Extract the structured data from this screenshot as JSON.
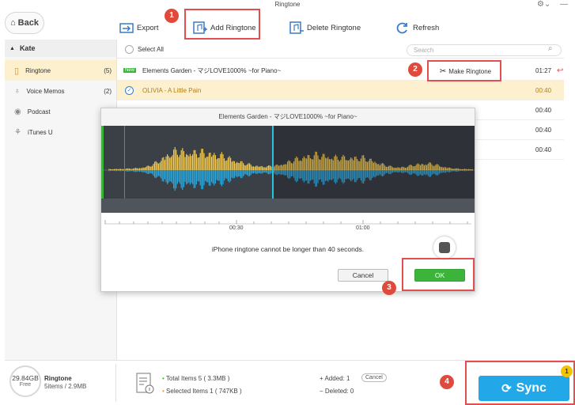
{
  "window": {
    "title": "Ringtone"
  },
  "nav": {
    "back_label": "Back"
  },
  "toolbar": {
    "export_label": "Export",
    "add_ringtone_label": "Add Ringtone",
    "delete_ringtone_label": "Delete Ringtone",
    "refresh_label": "Refresh"
  },
  "sidebar": {
    "device_name": "Kate",
    "items": [
      {
        "label": "Ringtone",
        "count": "(5)"
      },
      {
        "label": "Voice Memos",
        "count": "(2)"
      },
      {
        "label": "Podcast",
        "count": ""
      },
      {
        "label": "iTunes U",
        "count": ""
      }
    ]
  },
  "list": {
    "select_all_label": "Select All",
    "search_placeholder": "Search",
    "rows": [
      {
        "badge": "New",
        "title": "Elements Garden - マジLOVE1000% ~for Piano~",
        "duration": "01:27"
      },
      {
        "title": "OLIVIA - A Little Pain",
        "duration": "00:40"
      },
      {
        "duration": "00:40"
      },
      {
        "duration": "00:40"
      },
      {
        "duration": "00:40"
      }
    ],
    "make_ringtone_label": "Make Ringtone"
  },
  "dialog": {
    "title": "Elements Garden - マジLOVE1000% ~for Piano~",
    "tick_labels": [
      "00:30",
      "01:00"
    ],
    "message": "iPhone ringtone cannot be longer than 40 seconds.",
    "cancel_label": "Cancel",
    "ok_label": "OK"
  },
  "footer": {
    "storage_free": "29.84GB",
    "storage_free_label": "Free",
    "category": "Ringtone",
    "category_summary": "5items / 2.9MB",
    "total_items": "Total Items 5 ( 3.3MB )",
    "selected_items": "Selected Items 1 ( 747KB )",
    "added": "+ Added: 1",
    "added_cancel": "Cancel",
    "deleted": "− Deleted: 0",
    "sync_label": "Sync",
    "sync_badge": "1"
  },
  "steps": [
    "1",
    "2",
    "3",
    "4"
  ],
  "colors": {
    "accent": "#22a7e8",
    "highlight": "#fdf0cf",
    "annotation": "#e05050",
    "wave_gold": "#f2c94c",
    "wave_blue": "#29a8e0",
    "ok_green": "#3cb43c"
  }
}
